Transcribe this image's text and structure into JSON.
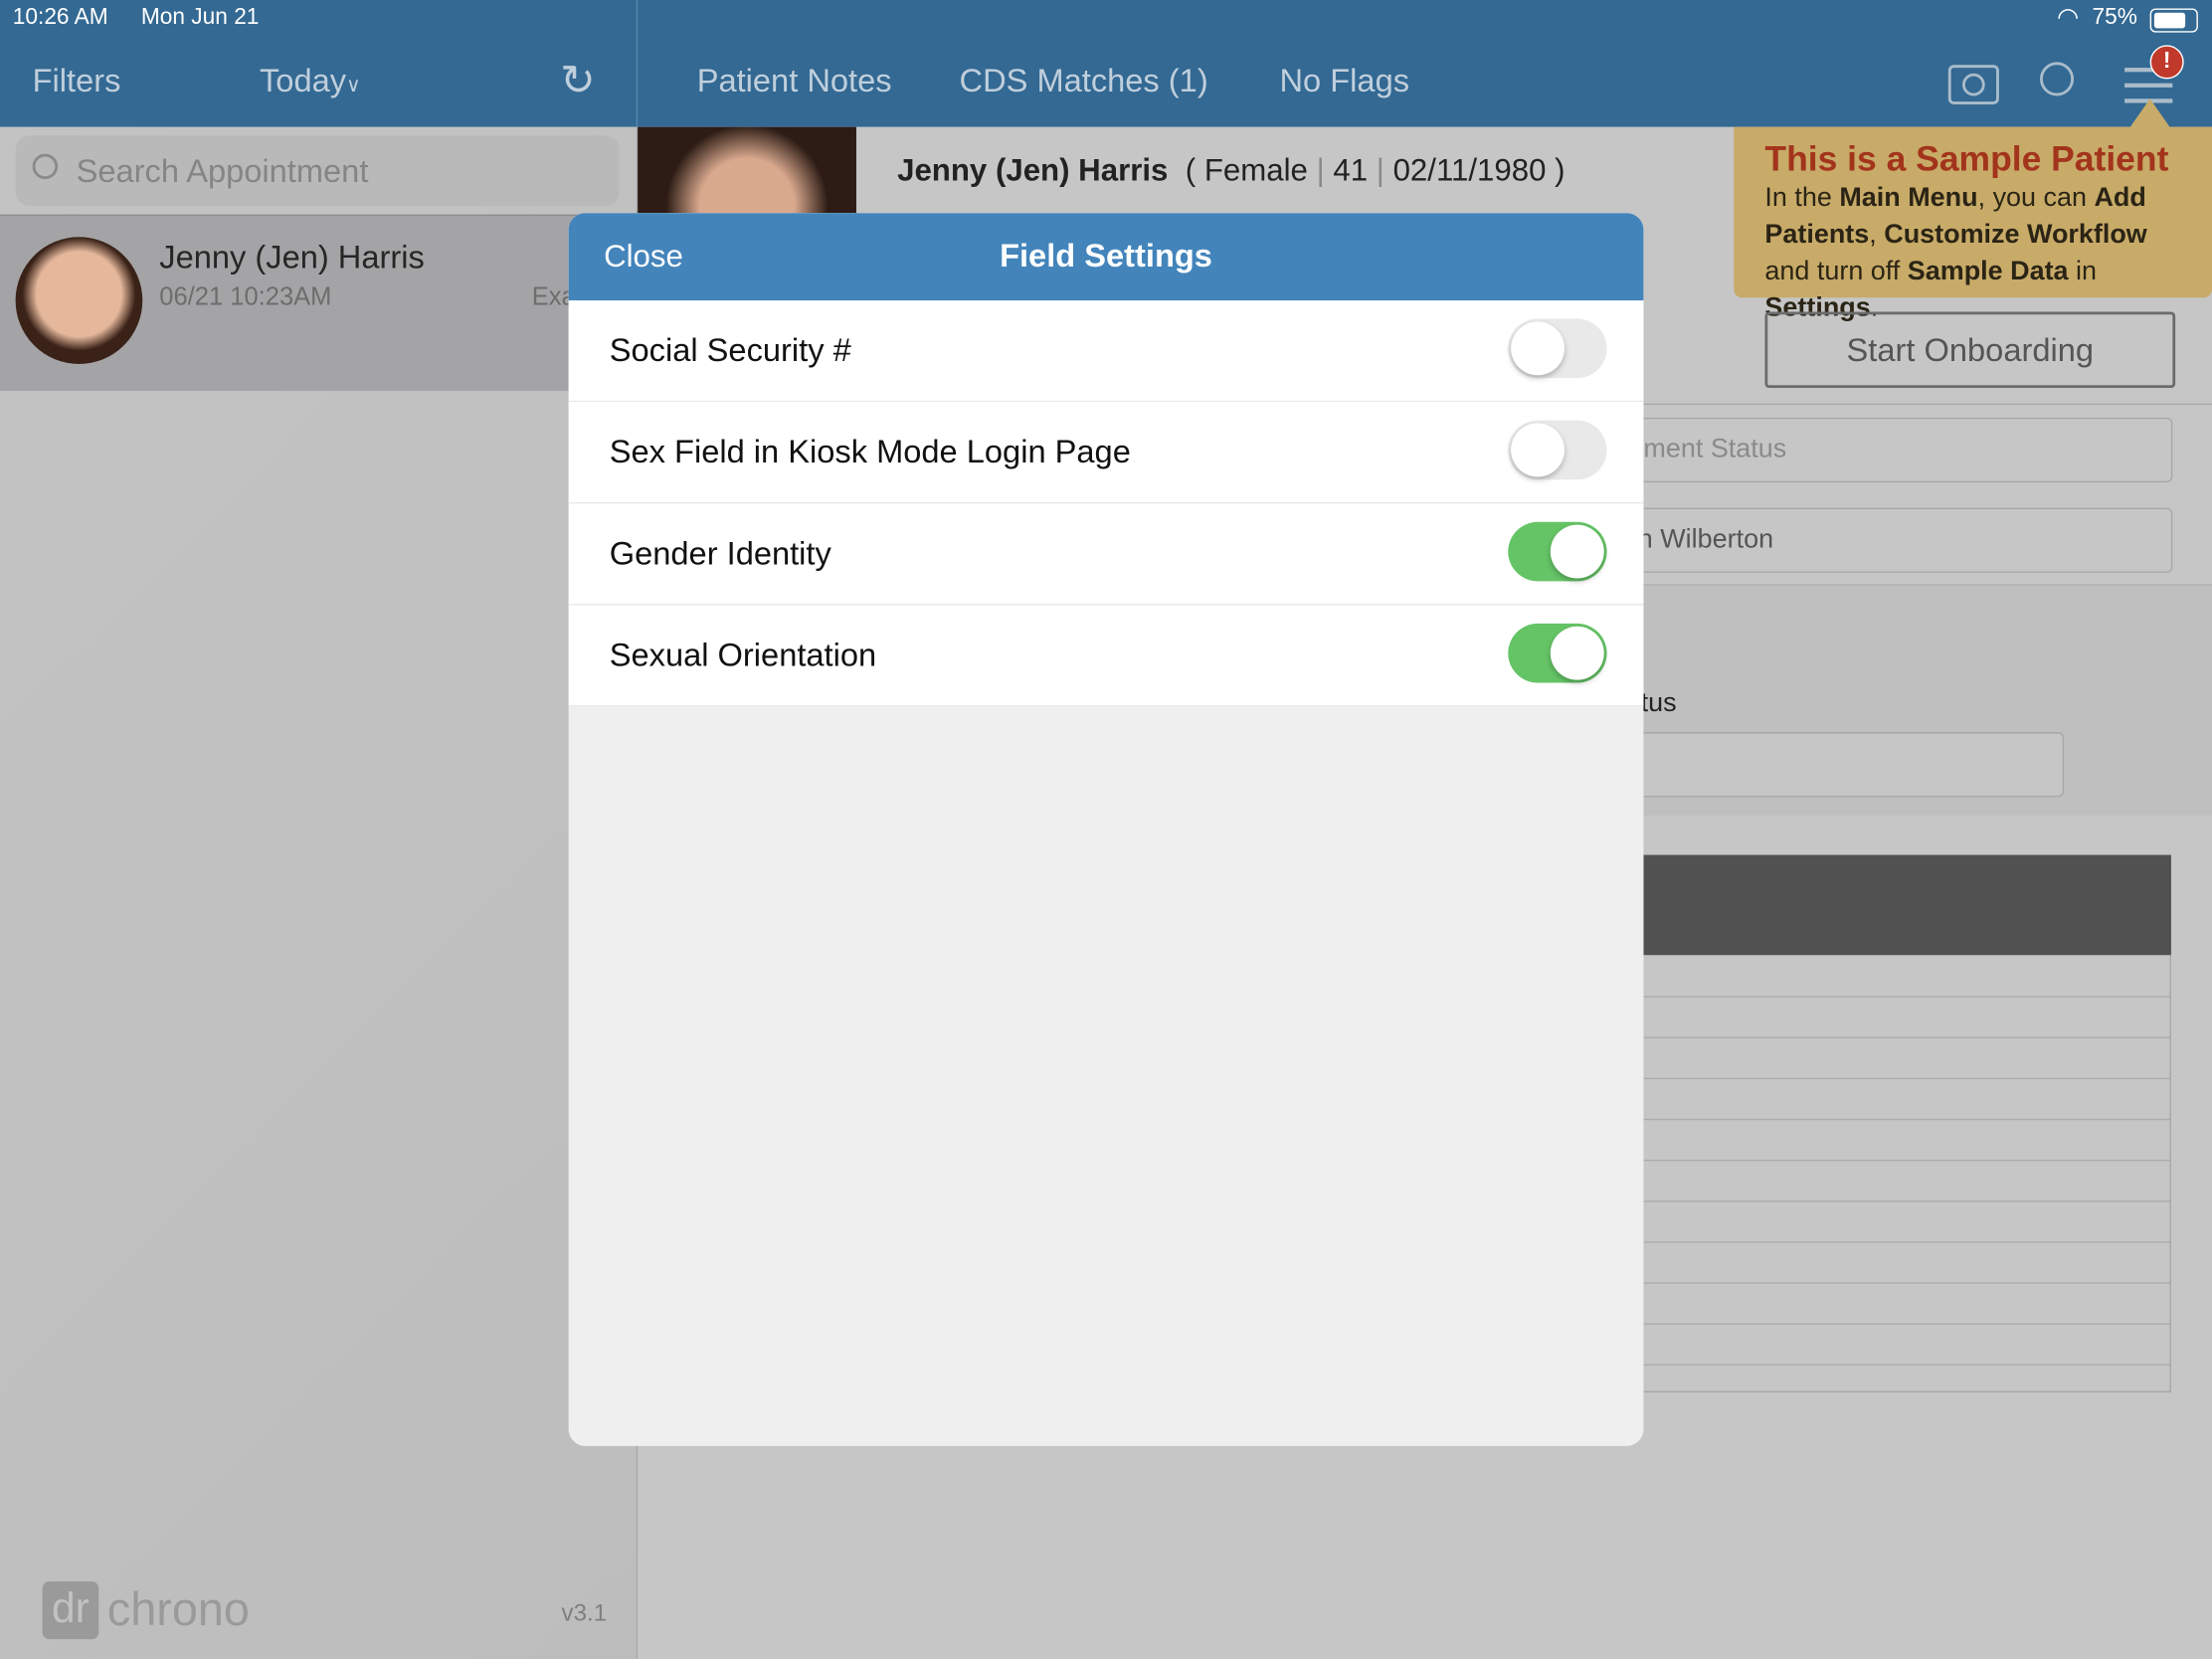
{
  "status_bar": {
    "time": "10:26 AM",
    "date": "Mon Jun 21",
    "battery": "75%",
    "battery_level": 0.75,
    "icons": [
      "wifi-icon",
      "battery-icon"
    ]
  },
  "left_nav": {
    "filters": "Filters",
    "today": "Today",
    "refresh_icon": "refresh-icon"
  },
  "top_nav": {
    "tabs": [
      "Patient Notes",
      "CDS Matches (1)",
      "No Flags"
    ],
    "icons": [
      "camera-icon",
      "search-icon",
      "menu-icon"
    ],
    "alert_badge": "!"
  },
  "search": {
    "placeholder": "Search Appointment"
  },
  "appointment": {
    "name": "Jenny (Jen) Harris",
    "time": "06/21 10:23AM",
    "type_truncated": "Exa"
  },
  "patient_header": {
    "name": "Jenny (Jen) Harris",
    "sex": "Female",
    "age": "41",
    "dob": "02/11/1980",
    "open": "(",
    "close": ")",
    "sep": "|"
  },
  "tooltip": {
    "title": "This is a Sample Patient",
    "t1": "In the ",
    "b1": "Main Menu",
    "t2": ", you can ",
    "b2": "Add Patients",
    "t3": ", ",
    "b3": "Customize Workflow",
    "t4": " and turn off ",
    "b4": "Sample Data",
    "t5": " in ",
    "b5": "Settings",
    "t6": "."
  },
  "background_form": {
    "onboarding": "Start Onboarding",
    "appt_status_placeholder": "ment Status",
    "provider": "n Wilberton",
    "status_label": "tus"
  },
  "footer": {
    "logo_dr": "dr",
    "logo_chrono": "chrono",
    "version": "v3.1"
  },
  "modal": {
    "title": "Field Settings",
    "close": "Close",
    "rows": [
      {
        "label": "Social Security #",
        "enabled": false
      },
      {
        "label": "Sex Field in Kiosk Mode Login Page",
        "enabled": false
      },
      {
        "label": "Gender Identity",
        "enabled": true
      },
      {
        "label": "Sexual Orientation",
        "enabled": true
      }
    ]
  },
  "colors": {
    "header": "#336993",
    "modal_header": "#4384bb",
    "toggle_on": "#65c466",
    "toggle_off": "#e9e9ea",
    "tooltip": "#c8ab68",
    "tooltip_title": "#a3341c"
  }
}
